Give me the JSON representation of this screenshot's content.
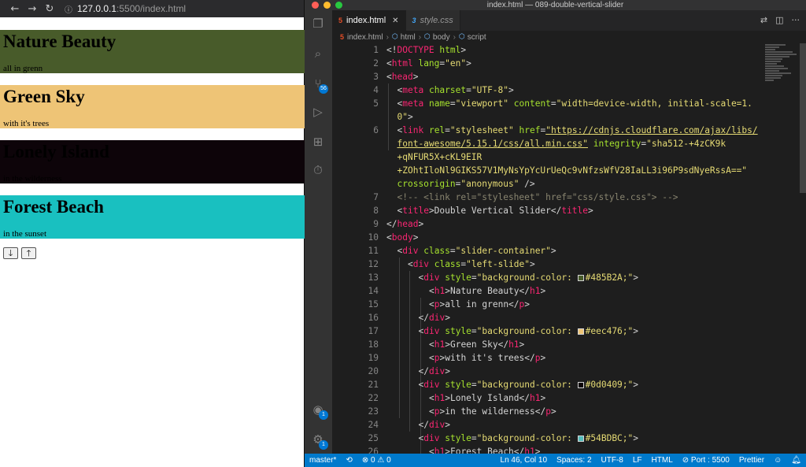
{
  "browser": {
    "nav": {
      "back": "←",
      "forward": "→",
      "reload": "↻"
    },
    "url_host": "127.0.0.1",
    "url_path": ":5500/index.html",
    "slides": [
      {
        "title": "Nature Beauty",
        "subtitle": "all in grenn",
        "bg": "#485B2A"
      },
      {
        "title": "Green Sky",
        "subtitle": "with it's trees",
        "bg": "#eec476"
      },
      {
        "title": "Lonely Island",
        "subtitle": "in the wilderness",
        "bg": "#0d0409"
      },
      {
        "title": "Forest Beach",
        "subtitle": "in the sunset",
        "bg": "#19c0c0"
      }
    ],
    "down_button": "🡓",
    "up_button": "🡑"
  },
  "vscode": {
    "window_title": "index.html — 089-double-vertical-slider",
    "traffic_colors": [
      "#ff5f57",
      "#febc2e",
      "#28c840"
    ],
    "tabs": [
      {
        "label": "index.html",
        "icon": "html5-icon",
        "active": true
      },
      {
        "label": "style.css",
        "icon": "css3-icon",
        "active": false
      }
    ],
    "breadcrumbs": [
      "index.html",
      "html",
      "body",
      "script"
    ],
    "activity_badges": {
      "source_control": "56",
      "accounts": "1",
      "settings": "1"
    },
    "status": {
      "branch": "master*",
      "problems": "⊗ 0 ⚠ 0",
      "position": "Ln 46, Col 10",
      "spaces": "Spaces: 2",
      "encoding": "UTF-8",
      "eol": "LF",
      "language": "HTML",
      "port": "⊘ Port : 5500",
      "prettier": "Prettier"
    },
    "code_lines": [
      {
        "n": "1",
        "indent": 0,
        "parts": [
          [
            "p",
            "<!"
          ],
          [
            "t",
            "DOCTYPE"
          ],
          [
            "p",
            " "
          ],
          [
            "a",
            "html"
          ],
          [
            "p",
            ">"
          ]
        ]
      },
      {
        "n": "2",
        "indent": 0,
        "parts": [
          [
            "p",
            "<"
          ],
          [
            "t",
            "html"
          ],
          [
            "p",
            " "
          ],
          [
            "a",
            "lang"
          ],
          [
            "p",
            "="
          ],
          [
            "s",
            "\"en\""
          ],
          [
            "p",
            ">"
          ]
        ]
      },
      {
        "n": "3",
        "indent": 0,
        "parts": [
          [
            "p",
            "<"
          ],
          [
            "t",
            "head"
          ],
          [
            "p",
            ">"
          ]
        ]
      },
      {
        "n": "4",
        "indent": 1,
        "parts": [
          [
            "p",
            "<"
          ],
          [
            "t",
            "meta"
          ],
          [
            "p",
            " "
          ],
          [
            "a",
            "charset"
          ],
          [
            "p",
            "="
          ],
          [
            "s",
            "\"UTF-8\""
          ],
          [
            "p",
            ">"
          ]
        ]
      },
      {
        "n": "5",
        "indent": 1,
        "parts": [
          [
            "p",
            "<"
          ],
          [
            "t",
            "meta"
          ],
          [
            "p",
            " "
          ],
          [
            "a",
            "name"
          ],
          [
            "p",
            "="
          ],
          [
            "s",
            "\"viewport\""
          ],
          [
            "p",
            " "
          ],
          [
            "a",
            "content"
          ],
          [
            "p",
            "="
          ],
          [
            "s",
            "\"width=device-width, initial-scale=1."
          ]
        ]
      },
      {
        "n": "",
        "indent": 1,
        "parts": [
          [
            "s",
            "0\""
          ],
          [
            "p",
            ">"
          ]
        ]
      },
      {
        "n": "6",
        "indent": 1,
        "parts": [
          [
            "p",
            "<"
          ],
          [
            "t",
            "link"
          ],
          [
            "p",
            " "
          ],
          [
            "a",
            "rel"
          ],
          [
            "p",
            "="
          ],
          [
            "s",
            "\"stylesheet\""
          ],
          [
            "p",
            " "
          ],
          [
            "a",
            "href"
          ],
          [
            "p",
            "="
          ],
          [
            "su",
            "\"https://cdnjs.cloudflare.com/ajax/libs/"
          ]
        ]
      },
      {
        "n": "",
        "indent": 1,
        "parts": [
          [
            "su",
            "font-awesome/5.15.1/css/all.min.css\""
          ],
          [
            "p",
            " "
          ],
          [
            "a",
            "integrity"
          ],
          [
            "p",
            "="
          ],
          [
            "s",
            "\"sha512-+4zCK9k"
          ]
        ]
      },
      {
        "n": "",
        "indent": 1,
        "parts": [
          [
            "s",
            "+qNFUR5X+cKL9EIR"
          ]
        ]
      },
      {
        "n": "",
        "indent": 1,
        "parts": [
          [
            "s",
            "+ZOhtIloNl9GIKS57V1MyNsYpYcUrUeQc9vNfzsWfV28IaLL3i96P9sdNyeRssA==\""
          ]
        ]
      },
      {
        "n": "",
        "indent": 1,
        "parts": [
          [
            "a",
            "crossorigin"
          ],
          [
            "p",
            "="
          ],
          [
            "s",
            "\"anonymous\""
          ],
          [
            "p",
            " />"
          ]
        ]
      },
      {
        "n": "7",
        "indent": 1,
        "parts": [
          [
            "c",
            "<!-- <link rel=\"stylesheet\" href=\"css/style.css\"> -->"
          ]
        ]
      },
      {
        "n": "8",
        "indent": 1,
        "parts": [
          [
            "p",
            "<"
          ],
          [
            "t",
            "title"
          ],
          [
            "p",
            ">Double Vertical Slider</"
          ],
          [
            "t",
            "title"
          ],
          [
            "p",
            ">"
          ]
        ]
      },
      {
        "n": "9",
        "indent": 0,
        "parts": [
          [
            "p",
            "</"
          ],
          [
            "t",
            "head"
          ],
          [
            "p",
            ">"
          ]
        ]
      },
      {
        "n": "10",
        "indent": 0,
        "parts": [
          [
            "p",
            "<"
          ],
          [
            "t",
            "body"
          ],
          [
            "p",
            ">"
          ]
        ]
      },
      {
        "n": "11",
        "indent": 1,
        "parts": [
          [
            "p",
            "<"
          ],
          [
            "t",
            "div"
          ],
          [
            "p",
            " "
          ],
          [
            "a",
            "class"
          ],
          [
            "p",
            "="
          ],
          [
            "s",
            "\"slider-container\""
          ],
          [
            "p",
            ">"
          ]
        ]
      },
      {
        "n": "12",
        "indent": 2,
        "parts": [
          [
            "p",
            "<"
          ],
          [
            "t",
            "div"
          ],
          [
            "p",
            " "
          ],
          [
            "a",
            "class"
          ],
          [
            "p",
            "="
          ],
          [
            "s",
            "\"left-slide\""
          ],
          [
            "p",
            ">"
          ]
        ]
      },
      {
        "n": "13",
        "indent": 3,
        "parts": [
          [
            "p",
            "<"
          ],
          [
            "t",
            "div"
          ],
          [
            "p",
            " "
          ],
          [
            "a",
            "style"
          ],
          [
            "p",
            "="
          ],
          [
            "s",
            "\"background-color: "
          ],
          [
            "sw",
            "#485B2A"
          ],
          [
            "s",
            "#485B2A;\""
          ],
          [
            "p",
            ">"
          ]
        ]
      },
      {
        "n": "14",
        "indent": 4,
        "parts": [
          [
            "p",
            "<"
          ],
          [
            "t",
            "h1"
          ],
          [
            "p",
            ">Nature Beauty</"
          ],
          [
            "t",
            "h1"
          ],
          [
            "p",
            ">"
          ]
        ]
      },
      {
        "n": "15",
        "indent": 4,
        "parts": [
          [
            "p",
            "<"
          ],
          [
            "t",
            "p"
          ],
          [
            "p",
            ">all in grenn</"
          ],
          [
            "t",
            "p"
          ],
          [
            "p",
            ">"
          ]
        ]
      },
      {
        "n": "16",
        "indent": 3,
        "parts": [
          [
            "p",
            "</"
          ],
          [
            "t",
            "div"
          ],
          [
            "p",
            ">"
          ]
        ]
      },
      {
        "n": "17",
        "indent": 3,
        "parts": [
          [
            "p",
            "<"
          ],
          [
            "t",
            "div"
          ],
          [
            "p",
            " "
          ],
          [
            "a",
            "style"
          ],
          [
            "p",
            "="
          ],
          [
            "s",
            "\"background-color: "
          ],
          [
            "sw",
            "#eec476"
          ],
          [
            "s",
            "#eec476;\""
          ],
          [
            "p",
            ">"
          ]
        ]
      },
      {
        "n": "18",
        "indent": 4,
        "parts": [
          [
            "p",
            "<"
          ],
          [
            "t",
            "h1"
          ],
          [
            "p",
            ">Green Sky</"
          ],
          [
            "t",
            "h1"
          ],
          [
            "p",
            ">"
          ]
        ]
      },
      {
        "n": "19",
        "indent": 4,
        "parts": [
          [
            "p",
            "<"
          ],
          [
            "t",
            "p"
          ],
          [
            "p",
            ">with it's trees</"
          ],
          [
            "t",
            "p"
          ],
          [
            "p",
            ">"
          ]
        ]
      },
      {
        "n": "20",
        "indent": 3,
        "parts": [
          [
            "p",
            "</"
          ],
          [
            "t",
            "div"
          ],
          [
            "p",
            ">"
          ]
        ]
      },
      {
        "n": "21",
        "indent": 3,
        "parts": [
          [
            "p",
            "<"
          ],
          [
            "t",
            "div"
          ],
          [
            "p",
            " "
          ],
          [
            "a",
            "style"
          ],
          [
            "p",
            "="
          ],
          [
            "s",
            "\"background-color: "
          ],
          [
            "sw",
            "#0d0409"
          ],
          [
            "s",
            "#0d0409;\""
          ],
          [
            "p",
            ">"
          ]
        ]
      },
      {
        "n": "22",
        "indent": 4,
        "parts": [
          [
            "p",
            "<"
          ],
          [
            "t",
            "h1"
          ],
          [
            "p",
            ">Lonely Island</"
          ],
          [
            "t",
            "h1"
          ],
          [
            "p",
            ">"
          ]
        ]
      },
      {
        "n": "23",
        "indent": 4,
        "parts": [
          [
            "p",
            "<"
          ],
          [
            "t",
            "p"
          ],
          [
            "p",
            ">in the wilderness</"
          ],
          [
            "t",
            "p"
          ],
          [
            "p",
            ">"
          ]
        ]
      },
      {
        "n": "24",
        "indent": 3,
        "parts": [
          [
            "p",
            "</"
          ],
          [
            "t",
            "div"
          ],
          [
            "p",
            ">"
          ]
        ]
      },
      {
        "n": "25",
        "indent": 3,
        "parts": [
          [
            "p",
            "<"
          ],
          [
            "t",
            "div"
          ],
          [
            "p",
            " "
          ],
          [
            "a",
            "style"
          ],
          [
            "p",
            "="
          ],
          [
            "s",
            "\"background-color: "
          ],
          [
            "sw",
            "#54BDBC"
          ],
          [
            "s",
            "#54BDBC;\""
          ],
          [
            "p",
            ">"
          ]
        ]
      },
      {
        "n": "26",
        "indent": 4,
        "parts": [
          [
            "p",
            "<"
          ],
          [
            "t",
            "h1"
          ],
          [
            "p",
            ">Forest Beach</"
          ],
          [
            "t",
            "h1"
          ],
          [
            "p",
            ">"
          ]
        ]
      }
    ]
  }
}
